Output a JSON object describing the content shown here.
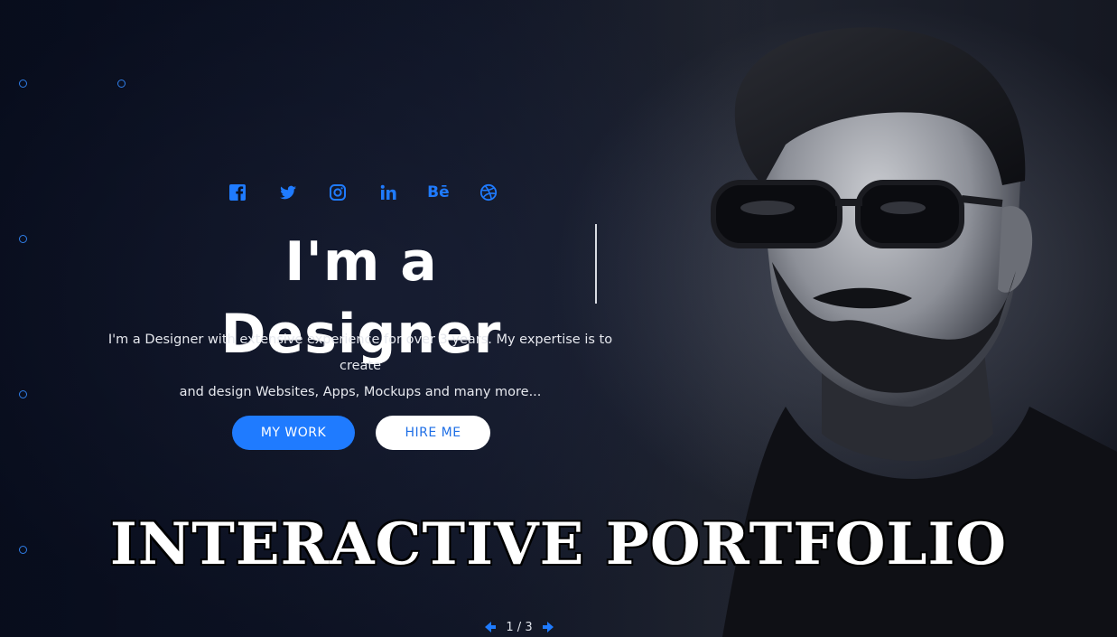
{
  "hero": {
    "title": "I'm a Designer",
    "description_line1": "I'm a Designer with extensive experience for over 3 years. My expertise is to create",
    "description_line2": "and design Websites, Apps, Mockups and many more...",
    "buttons": {
      "work_label": "MY WORK",
      "hire_label": "HIRE ME"
    }
  },
  "social": [
    {
      "icon": "facebook-icon"
    },
    {
      "icon": "twitter-icon"
    },
    {
      "icon": "instagram-icon"
    },
    {
      "icon": "linkedin-icon"
    },
    {
      "icon": "behance-icon",
      "label": "Bē"
    },
    {
      "icon": "dribbble-icon"
    }
  ],
  "banner": {
    "text": "INTERACTIVE PORTFOLIO"
  },
  "pager": {
    "text": "1 / 3"
  },
  "colors": {
    "accent": "#1f7bff",
    "background": "#070b18",
    "text": "#ffffff"
  }
}
